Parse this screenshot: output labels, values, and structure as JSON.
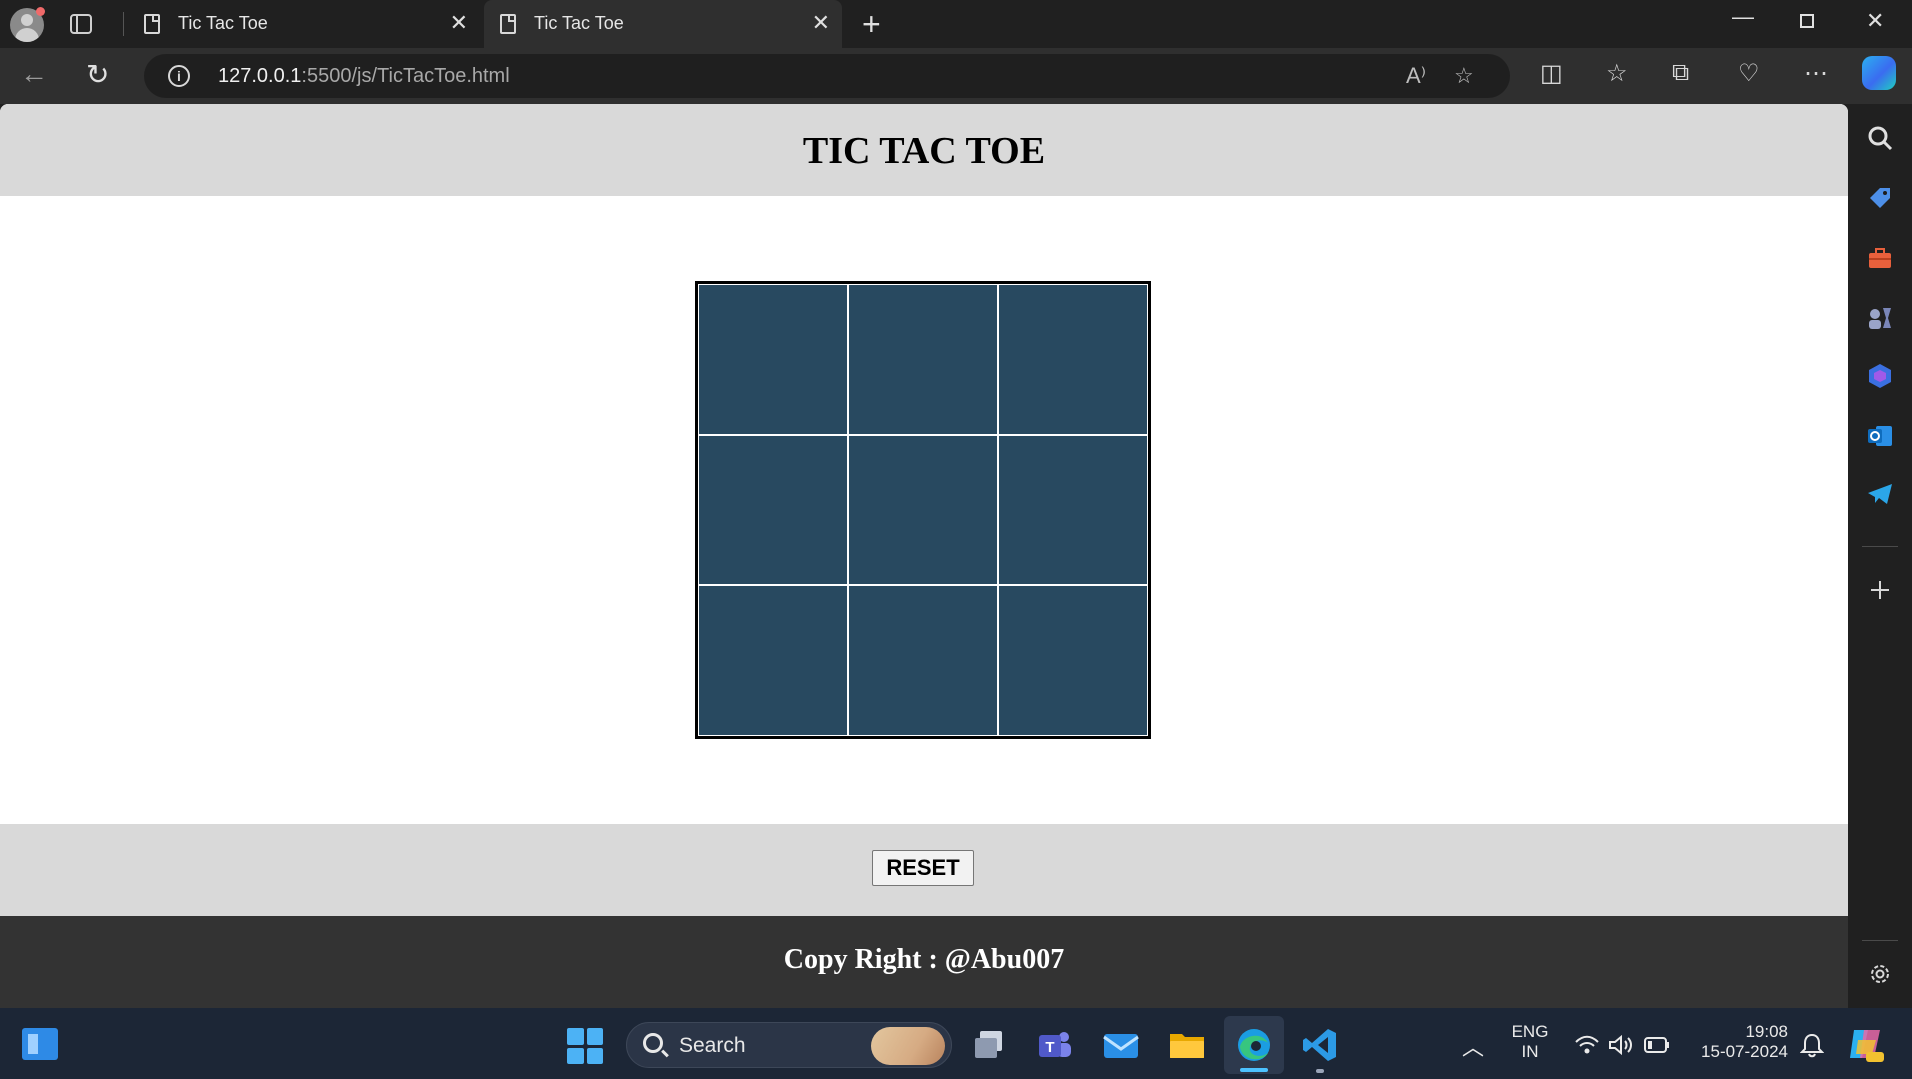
{
  "browser": {
    "tabs": [
      {
        "title": "Tic Tac Toe",
        "active": false
      },
      {
        "title": "Tic Tac Toe",
        "active": true
      }
    ],
    "url_host": "127.0.0.1",
    "url_rest": ":5500/js/TicTacToe.html",
    "new_tab_symbol": "+",
    "close_symbol": "✕"
  },
  "page": {
    "title": "TIC TAC TOE",
    "board": {
      "cell_color": "#284960",
      "cells": [
        "",
        "",
        "",
        "",
        "",
        "",
        "",
        "",
        ""
      ]
    },
    "reset_label": "RESET",
    "footer": "Copy Right : @Abu007"
  },
  "taskbar": {
    "search_label": "Search",
    "lang_top": "ENG",
    "lang_bottom": "IN",
    "time": "19:08",
    "date": "15-07-2024"
  },
  "icons": {
    "toolbar": [
      "read-aloud-icon",
      "favorite-star-icon",
      "split-screen-icon",
      "favorites-icon",
      "collections-icon",
      "browser-essentials-icon",
      "more-icon",
      "copilot-icon"
    ],
    "sidebar": [
      "search-icon",
      "shopping-tag-icon",
      "tools-icon",
      "games-icon",
      "microsoft-365-icon",
      "outlook-icon",
      "telegram-icon",
      "add-icon",
      "settings-icon"
    ]
  }
}
